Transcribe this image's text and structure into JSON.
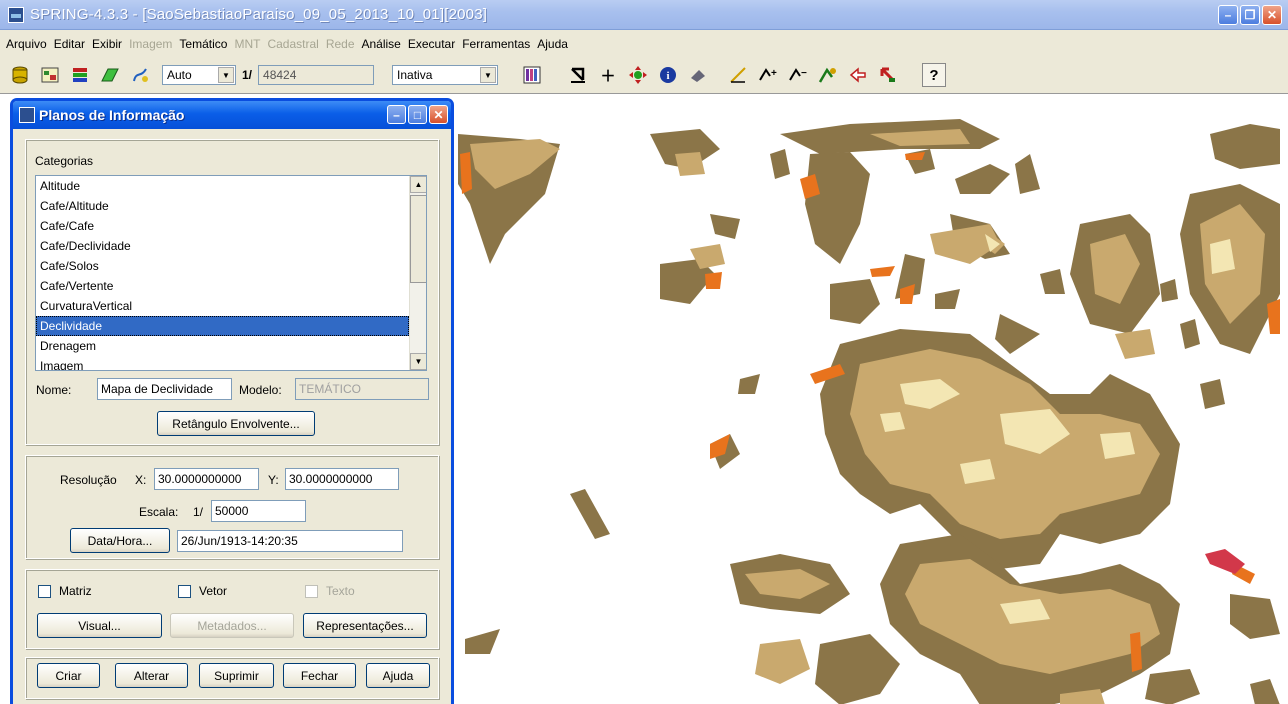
{
  "window": {
    "title": "SPRING-4.3.3 - [SaoSebastiaoParaiso_09_05_2013_10_01][2003]"
  },
  "menu": [
    {
      "label": "Arquivo",
      "enabled": true
    },
    {
      "label": "Editar",
      "enabled": true
    },
    {
      "label": "Exibir",
      "enabled": true
    },
    {
      "label": "Imagem",
      "enabled": false
    },
    {
      "label": "Temático",
      "enabled": true
    },
    {
      "label": "MNT",
      "enabled": false
    },
    {
      "label": "Cadastral",
      "enabled": false
    },
    {
      "label": "Rede",
      "enabled": false
    },
    {
      "label": "Análise",
      "enabled": true
    },
    {
      "label": "Executar",
      "enabled": true
    },
    {
      "label": "Ferramentas",
      "enabled": true
    },
    {
      "label": "Ajuda",
      "enabled": true
    }
  ],
  "toolbar": {
    "zoom_mode": "Auto",
    "scale_prefix": "1/",
    "scale_value": "48424",
    "state": "Inativa",
    "help_glyph": "?"
  },
  "dialog": {
    "title": "Planos de Informação",
    "categories_label": "Categorias",
    "categories": [
      "Altitude",
      "Cafe/Altitude",
      "Cafe/Cafe",
      "Cafe/Declividade",
      "Cafe/Solos",
      "Cafe/Vertente",
      "CurvaturaVertical",
      "Declividade",
      "Drenagem",
      "Imagem"
    ],
    "selected_category": "Declividade",
    "nome_label": "Nome:",
    "nome_value": "Mapa de Declividade",
    "modelo_label": "Modelo:",
    "modelo_value": "TEMÁTICO",
    "retangulo_button": "Retângulo Envolvente...",
    "resolucao_label": "Resolução",
    "x_label": "X:",
    "x_value": "30.0000000000",
    "y_label": "Y:",
    "y_value": "30.0000000000",
    "escala_label": "Escala:",
    "escala_prefix": "1/",
    "escala_value": "50000",
    "datahora_button": "Data/Hora...",
    "datahora_value": "26/Jun/1913-14:20:35",
    "matriz_label": "Matriz",
    "vetor_label": "Vetor",
    "texto_label": "Texto",
    "visual_button": "Visual...",
    "metadados_button": "Metadados...",
    "representacoes_button": "Representações...",
    "criar_button": "Criar",
    "alterar_button": "Alterar",
    "suprimir_button": "Suprimir",
    "fechar_button": "Fechar",
    "ajuda_button": "Ajuda"
  },
  "colors": {
    "map_dark": "#8b7548",
    "map_medium": "#c9a96e",
    "map_light": "#f3e6b3",
    "map_orange": "#e8731d",
    "map_red": "#d2384a",
    "selection": "#316ac5",
    "dialog_border": "#0a4ddf"
  }
}
